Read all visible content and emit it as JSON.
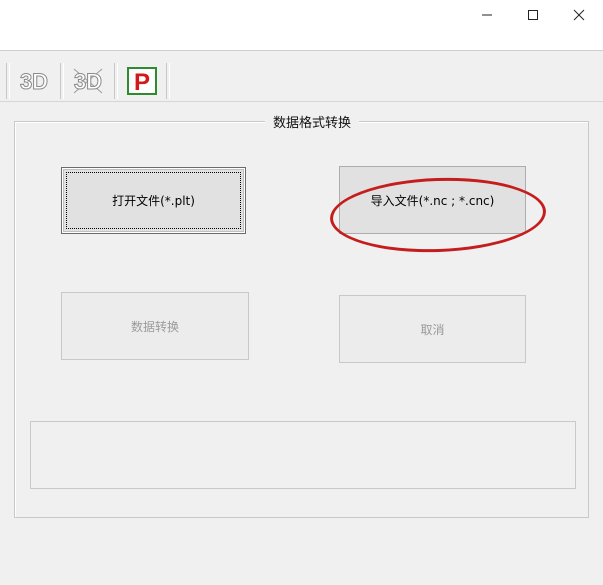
{
  "window": {
    "controls": {
      "minimize_icon": "minimize-icon",
      "maximize_icon": "maximize-icon",
      "close_icon": "close-icon"
    }
  },
  "toolbar": {
    "buttons": [
      {
        "icon": "3d-view-icon",
        "label": "3D"
      },
      {
        "icon": "3d-view-alt-icon",
        "label": "3D"
      },
      {
        "icon": "p-logo-icon",
        "label": "P"
      }
    ]
  },
  "group": {
    "title": "数据格式转换"
  },
  "buttons": {
    "open_file": "打开文件(*.plt)",
    "import_file": "导入文件(*.nc ; *.cnc)",
    "convert": "数据转换",
    "cancel": "取消"
  },
  "colors": {
    "annotation": "#c51d1d",
    "window_bg": "#f0f0f0",
    "button_face": "#e1e1e1"
  }
}
